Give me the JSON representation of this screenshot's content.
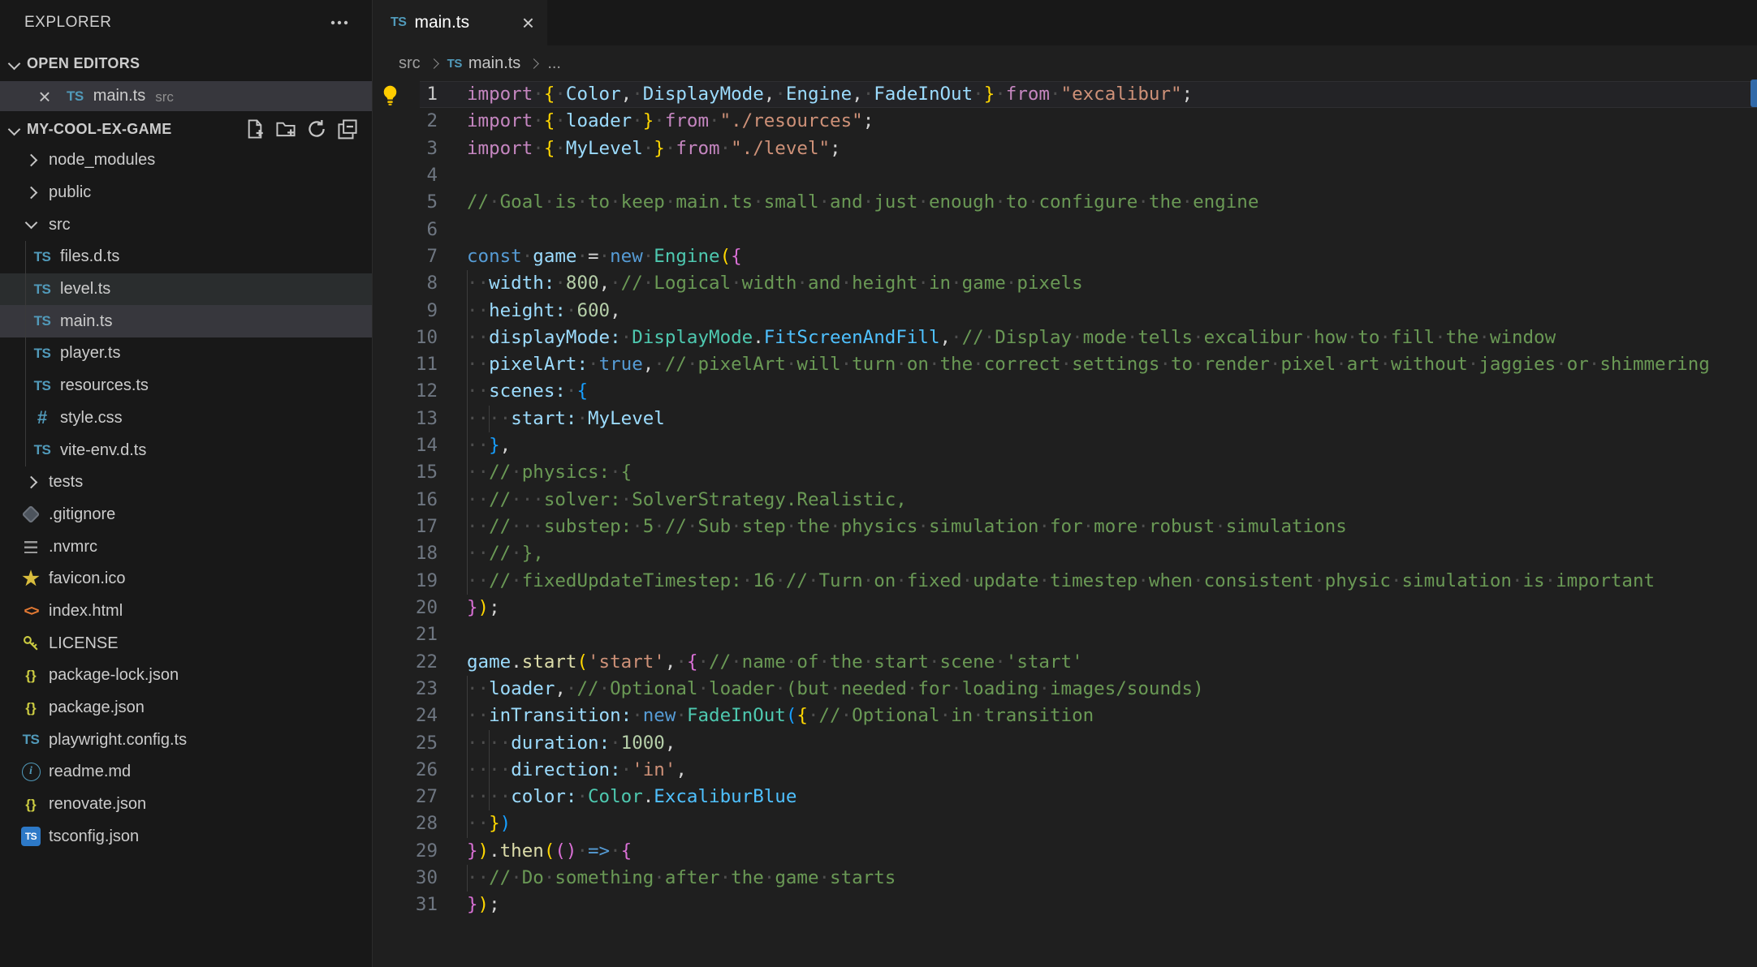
{
  "colors": {
    "sidebar_bg": "#181818",
    "editor_bg": "#1f1f1f",
    "selected_row": "#37373d",
    "hover_row": "#2a2d2e",
    "keyword_pink": "#C586C0",
    "keyword_blue": "#569CD6",
    "variable": "#9CDCFE",
    "type_teal": "#4EC9B0",
    "enum_member": "#4FC1FF",
    "function": "#DCDCAA",
    "string": "#CE9178",
    "number": "#B5CEA8",
    "comment": "#6A9955",
    "bracket1": "#FFD700",
    "bracket2": "#DA70D6",
    "bracket3": "#179FFF",
    "ts_icon": "#519aba",
    "lightbulb": "#FFCC00"
  },
  "sidebar": {
    "title": "EXPLORER",
    "more_actions_icon": "ellipsis-icon",
    "open_editors": {
      "label": "OPEN EDITORS",
      "items": [
        {
          "name": "main.ts",
          "desc": "src",
          "icon": "ts",
          "close_icon": "×"
        }
      ]
    },
    "project": {
      "label": "MY-COOL-EX-GAME",
      "actions": [
        "new-file",
        "new-folder",
        "refresh",
        "collapse-all"
      ]
    },
    "tree": [
      {
        "label": "node_modules",
        "icon": "folder",
        "depth": 1,
        "expanded": false
      },
      {
        "label": "public",
        "icon": "folder",
        "depth": 1,
        "expanded": false
      },
      {
        "label": "src",
        "icon": "folder",
        "depth": 1,
        "expanded": true
      },
      {
        "label": "files.d.ts",
        "icon": "ts",
        "depth": 2
      },
      {
        "label": "level.ts",
        "icon": "ts",
        "depth": 2,
        "state": "hover"
      },
      {
        "label": "main.ts",
        "icon": "ts",
        "depth": 2,
        "state": "selected"
      },
      {
        "label": "player.ts",
        "icon": "ts",
        "depth": 2
      },
      {
        "label": "resources.ts",
        "icon": "ts",
        "depth": 2
      },
      {
        "label": "style.css",
        "icon": "css",
        "depth": 2
      },
      {
        "label": "vite-env.d.ts",
        "icon": "ts",
        "depth": 2
      },
      {
        "label": "tests",
        "icon": "folder",
        "depth": 1,
        "expanded": false
      },
      {
        "label": ".gitignore",
        "icon": "git",
        "depth": 1
      },
      {
        "label": ".nvmrc",
        "icon": "nvm",
        "depth": 1
      },
      {
        "label": "favicon.ico",
        "icon": "star",
        "depth": 1
      },
      {
        "label": "index.html",
        "icon": "html",
        "depth": 1
      },
      {
        "label": "LICENSE",
        "icon": "key",
        "depth": 1
      },
      {
        "label": "package-lock.json",
        "icon": "json",
        "depth": 1
      },
      {
        "label": "package.json",
        "icon": "json",
        "depth": 1
      },
      {
        "label": "playwright.config.ts",
        "icon": "ts",
        "depth": 1
      },
      {
        "label": "readme.md",
        "icon": "info",
        "depth": 1
      },
      {
        "label": "renovate.json",
        "icon": "json",
        "depth": 1
      },
      {
        "label": "tsconfig.json",
        "icon": "tsblue",
        "depth": 1
      }
    ]
  },
  "tabbar": {
    "tabs": [
      {
        "label": "main.ts",
        "icon": "ts",
        "close_icon": "×",
        "active": true
      }
    ]
  },
  "breadcrumb": {
    "folder": "src",
    "file": "main.ts",
    "ellipsis": "..."
  },
  "editor": {
    "cursor_line": 1,
    "lightbulb_line": 1,
    "lines": [
      {
        "n": 1,
        "g": 0,
        "t": [
          [
            "import",
            "kp"
          ],
          [
            " "
          ],
          [
            "{",
            "b1"
          ],
          [
            " "
          ],
          [
            "Color",
            "v"
          ],
          [
            ",",
            "p"
          ],
          [
            " "
          ],
          [
            "DisplayMode",
            "v"
          ],
          [
            ",",
            "p"
          ],
          [
            " "
          ],
          [
            "Engine",
            "v"
          ],
          [
            ",",
            "p"
          ],
          [
            " "
          ],
          [
            "FadeInOut",
            "v"
          ],
          [
            " "
          ],
          [
            "}",
            "b1"
          ],
          [
            " "
          ],
          [
            "from",
            "kp"
          ],
          [
            " "
          ],
          [
            "\"excalibur\"",
            "s"
          ],
          [
            ";",
            "p"
          ]
        ]
      },
      {
        "n": 2,
        "g": 0,
        "t": [
          [
            "import",
            "kp"
          ],
          [
            " "
          ],
          [
            "{",
            "b1"
          ],
          [
            " "
          ],
          [
            "loader",
            "v"
          ],
          [
            " "
          ],
          [
            "}",
            "b1"
          ],
          [
            " "
          ],
          [
            "from",
            "kp"
          ],
          [
            " "
          ],
          [
            "\"./resources\"",
            "s"
          ],
          [
            ";",
            "p"
          ]
        ]
      },
      {
        "n": 3,
        "g": 0,
        "t": [
          [
            "import",
            "kp"
          ],
          [
            " "
          ],
          [
            "{",
            "b1"
          ],
          [
            " "
          ],
          [
            "MyLevel",
            "v"
          ],
          [
            " "
          ],
          [
            "}",
            "b1"
          ],
          [
            " "
          ],
          [
            "from",
            "kp"
          ],
          [
            " "
          ],
          [
            "\"./level\"",
            "s"
          ],
          [
            ";",
            "p"
          ]
        ]
      },
      {
        "n": 4,
        "g": 0,
        "t": []
      },
      {
        "n": 5,
        "g": 0,
        "t": [
          [
            "// Goal is to keep main.ts small and just enough to configure the engine",
            "c"
          ]
        ]
      },
      {
        "n": 6,
        "g": 0,
        "t": []
      },
      {
        "n": 7,
        "g": 0,
        "t": [
          [
            "const",
            "kb"
          ],
          [
            " "
          ],
          [
            "game",
            "v"
          ],
          [
            " "
          ],
          [
            "=",
            "p"
          ],
          [
            " "
          ],
          [
            "new",
            "kb"
          ],
          [
            " "
          ],
          [
            "Engine",
            "ty"
          ],
          [
            "(",
            "b1"
          ],
          [
            "{",
            "b2"
          ]
        ]
      },
      {
        "n": 8,
        "g": 1,
        "t": [
          [
            "  "
          ],
          [
            "width",
            "v"
          ],
          [
            ":",
            "v"
          ],
          [
            " "
          ],
          [
            "800",
            "n"
          ],
          [
            ",",
            "p"
          ],
          [
            " "
          ],
          [
            "// Logical width and height in game pixels",
            "c"
          ]
        ]
      },
      {
        "n": 9,
        "g": 1,
        "t": [
          [
            "  "
          ],
          [
            "height",
            "v"
          ],
          [
            ":",
            "v"
          ],
          [
            " "
          ],
          [
            "600",
            "n"
          ],
          [
            ",",
            "p"
          ]
        ]
      },
      {
        "n": 10,
        "g": 1,
        "t": [
          [
            "  "
          ],
          [
            "displayMode",
            "v"
          ],
          [
            ":",
            "v"
          ],
          [
            " "
          ],
          [
            "DisplayMode",
            "ty"
          ],
          [
            ".",
            "p"
          ],
          [
            "FitScreenAndFill",
            "em"
          ],
          [
            ",",
            "p"
          ],
          [
            " "
          ],
          [
            "// Display mode tells excalibur how to fill the window",
            "c"
          ]
        ]
      },
      {
        "n": 11,
        "g": 1,
        "t": [
          [
            "  "
          ],
          [
            "pixelArt",
            "v"
          ],
          [
            ":",
            "v"
          ],
          [
            " "
          ],
          [
            "true",
            "kb"
          ],
          [
            ",",
            "p"
          ],
          [
            " "
          ],
          [
            "// pixelArt will turn on the correct settings to render pixel art without jaggies or shimmering",
            "c"
          ]
        ]
      },
      {
        "n": 12,
        "g": 1,
        "t": [
          [
            "  "
          ],
          [
            "scenes",
            "v"
          ],
          [
            ":",
            "v"
          ],
          [
            " "
          ],
          [
            "{",
            "b3"
          ]
        ]
      },
      {
        "n": 13,
        "g": 2,
        "t": [
          [
            "    "
          ],
          [
            "start",
            "v"
          ],
          [
            ":",
            "v"
          ],
          [
            " "
          ],
          [
            "MyLevel",
            "v"
          ]
        ]
      },
      {
        "n": 14,
        "g": 1,
        "t": [
          [
            "  "
          ],
          [
            "}",
            "b3"
          ],
          [
            ",",
            "p"
          ]
        ]
      },
      {
        "n": 15,
        "g": 1,
        "t": [
          [
            "  "
          ],
          [
            "// physics: {",
            "c"
          ]
        ]
      },
      {
        "n": 16,
        "g": 1,
        "t": [
          [
            "  "
          ],
          [
            "//   solver: SolverStrategy.Realistic,",
            "c"
          ]
        ]
      },
      {
        "n": 17,
        "g": 1,
        "t": [
          [
            "  "
          ],
          [
            "//   substep: 5 // Sub step the physics simulation for more robust simulations",
            "c"
          ]
        ]
      },
      {
        "n": 18,
        "g": 1,
        "t": [
          [
            "  "
          ],
          [
            "// },",
            "c"
          ]
        ]
      },
      {
        "n": 19,
        "g": 1,
        "t": [
          [
            "  "
          ],
          [
            "// fixedUpdateTimestep: 16 // Turn on fixed update timestep when consistent physic simulation is important",
            "c"
          ]
        ]
      },
      {
        "n": 20,
        "g": 0,
        "t": [
          [
            "}",
            "b2"
          ],
          [
            ")",
            "b1"
          ],
          [
            ";",
            "p"
          ]
        ]
      },
      {
        "n": 21,
        "g": 0,
        "t": []
      },
      {
        "n": 22,
        "g": 0,
        "t": [
          [
            "game",
            "v"
          ],
          [
            ".",
            "p"
          ],
          [
            "start",
            "fn"
          ],
          [
            "(",
            "b1"
          ],
          [
            "'start'",
            "s"
          ],
          [
            ",",
            "p"
          ],
          [
            " "
          ],
          [
            "{",
            "b2"
          ],
          [
            " "
          ],
          [
            "// name of the start scene 'start'",
            "c"
          ]
        ]
      },
      {
        "n": 23,
        "g": 1,
        "t": [
          [
            "  "
          ],
          [
            "loader",
            "v"
          ],
          [
            ",",
            "p"
          ],
          [
            " "
          ],
          [
            "// Optional loader (but needed for loading images/sounds)",
            "c"
          ]
        ]
      },
      {
        "n": 24,
        "g": 1,
        "t": [
          [
            "  "
          ],
          [
            "inTransition",
            "v"
          ],
          [
            ":",
            "v"
          ],
          [
            " "
          ],
          [
            "new",
            "kb"
          ],
          [
            " "
          ],
          [
            "FadeInOut",
            "ty"
          ],
          [
            "(",
            "b3"
          ],
          [
            "{",
            "b1"
          ],
          [
            " "
          ],
          [
            "// Optional in transition",
            "c"
          ]
        ]
      },
      {
        "n": 25,
        "g": 2,
        "t": [
          [
            "    "
          ],
          [
            "duration",
            "v"
          ],
          [
            ":",
            "v"
          ],
          [
            " "
          ],
          [
            "1000",
            "n"
          ],
          [
            ",",
            "p"
          ]
        ]
      },
      {
        "n": 26,
        "g": 2,
        "t": [
          [
            "    "
          ],
          [
            "direction",
            "v"
          ],
          [
            ":",
            "v"
          ],
          [
            " "
          ],
          [
            "'in'",
            "s"
          ],
          [
            ",",
            "p"
          ]
        ]
      },
      {
        "n": 27,
        "g": 2,
        "t": [
          [
            "    "
          ],
          [
            "color",
            "v"
          ],
          [
            ":",
            "v"
          ],
          [
            " "
          ],
          [
            "Color",
            "ty"
          ],
          [
            ".",
            "p"
          ],
          [
            "ExcaliburBlue",
            "em"
          ]
        ]
      },
      {
        "n": 28,
        "g": 1,
        "t": [
          [
            "  "
          ],
          [
            "}",
            "b1"
          ],
          [
            ")",
            "b3"
          ]
        ]
      },
      {
        "n": 29,
        "g": 0,
        "t": [
          [
            "}",
            "b2"
          ],
          [
            ")",
            "b1"
          ],
          [
            ".",
            "p"
          ],
          [
            "then",
            "fn"
          ],
          [
            "(",
            "b1"
          ],
          [
            "(",
            "b2"
          ],
          [
            ")",
            "b2"
          ],
          [
            " "
          ],
          [
            "=>",
            "kb"
          ],
          [
            " "
          ],
          [
            "{",
            "b2"
          ]
        ]
      },
      {
        "n": 30,
        "g": 1,
        "t": [
          [
            "  "
          ],
          [
            "// Do something after the game starts",
            "c"
          ]
        ]
      },
      {
        "n": 31,
        "g": 0,
        "t": [
          [
            "}",
            "b2"
          ],
          [
            ")",
            "b1"
          ],
          [
            ";",
            "p"
          ]
        ]
      }
    ]
  }
}
